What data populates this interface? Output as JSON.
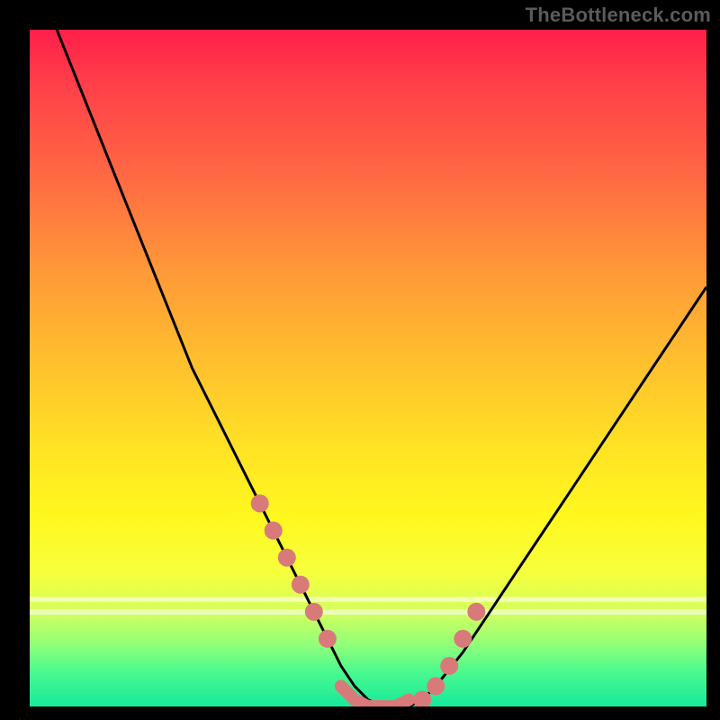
{
  "watermark": "TheBottleneck.com",
  "colors": {
    "background": "#000000",
    "curve": "#000000",
    "marker": "#d97a7a",
    "marker_eye": "#f0a8a8"
  },
  "chart_data": {
    "type": "line",
    "title": "",
    "xlabel": "",
    "ylabel": "",
    "xlim": [
      0,
      100
    ],
    "ylim": [
      0,
      100
    ],
    "grid": false,
    "legend": false,
    "x": [
      4,
      8,
      12,
      16,
      20,
      24,
      28,
      32,
      34,
      36,
      38,
      40,
      42,
      44,
      46,
      48,
      50,
      52,
      54,
      56,
      58,
      60,
      64,
      68,
      72,
      76,
      80,
      84,
      88,
      92,
      96,
      100
    ],
    "values": [
      100,
      90,
      80,
      70,
      60,
      50,
      42,
      34,
      30,
      26,
      22,
      18,
      14,
      10,
      6,
      3,
      1,
      0,
      0,
      0,
      1,
      3,
      8,
      14,
      20,
      26,
      32,
      38,
      44,
      50,
      56,
      62
    ],
    "markers": {
      "left_cluster_x": [
        34,
        36,
        38,
        40,
        42,
        44
      ],
      "left_cluster_y": [
        30,
        26,
        22,
        18,
        14,
        10
      ],
      "right_cluster_x": [
        58,
        60,
        62,
        64,
        66
      ],
      "right_cluster_y": [
        1,
        3,
        6,
        10,
        14
      ],
      "trough_x": [
        46,
        48,
        50,
        52,
        54,
        56
      ],
      "trough_y": [
        3,
        1,
        0,
        0,
        0,
        1
      ]
    }
  }
}
